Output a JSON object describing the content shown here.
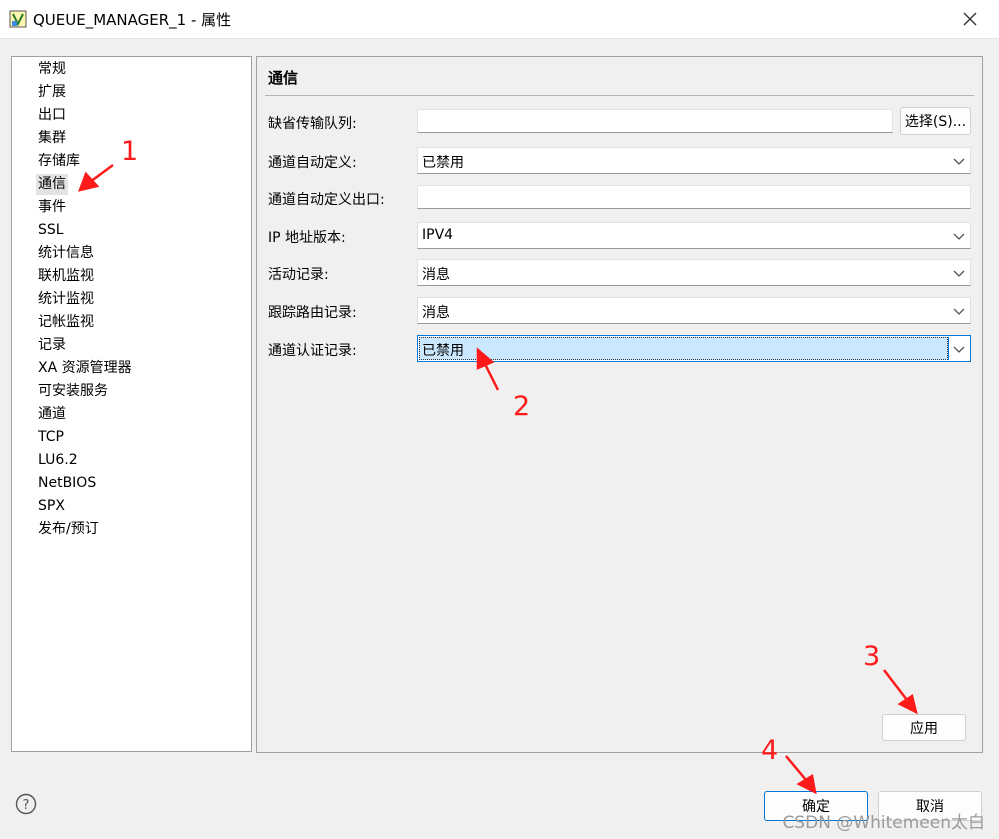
{
  "window": {
    "title": "QUEUE_MANAGER_1 - 属性"
  },
  "tree": {
    "items": [
      {
        "label": "常规"
      },
      {
        "label": "扩展"
      },
      {
        "label": "出口"
      },
      {
        "label": "集群"
      },
      {
        "label": "存储库"
      },
      {
        "label": "通信",
        "selected": true
      },
      {
        "label": "事件"
      },
      {
        "label": "SSL"
      },
      {
        "label": "统计信息"
      },
      {
        "label": "联机监视"
      },
      {
        "label": "统计监视"
      },
      {
        "label": "记帐监视"
      },
      {
        "label": "记录"
      },
      {
        "label": "XA 资源管理器"
      },
      {
        "label": "可安装服务"
      },
      {
        "label": "通道"
      },
      {
        "label": "TCP"
      },
      {
        "label": "LU6.2"
      },
      {
        "label": "NetBIOS"
      },
      {
        "label": "SPX"
      },
      {
        "label": "发布/预订"
      }
    ]
  },
  "panel": {
    "title": "通信",
    "fields": {
      "default_xmit_queue": {
        "label": "缺省传输队列:",
        "value": "",
        "select_label": "选择(S)..."
      },
      "chad": {
        "label": "通道自动定义:",
        "value": "已禁用"
      },
      "chad_exit": {
        "label": "通道自动定义出口:",
        "value": ""
      },
      "ip_version": {
        "label": "IP 地址版本:",
        "value": "IPV4"
      },
      "activity_recording": {
        "label": "活动记录:",
        "value": "消息"
      },
      "trace_route_recording": {
        "label": "跟踪路由记录:",
        "value": "消息"
      },
      "channel_auth_recording": {
        "label": "通道认证记录:",
        "value": "已禁用"
      }
    },
    "apply_label": "应用"
  },
  "footer": {
    "ok_label": "确定",
    "cancel_label": "取消"
  },
  "annotations": [
    "1",
    "2",
    "3",
    "4"
  ],
  "watermark": "CSDN @Whitemeen太白",
  "colors": {
    "accent": "#0078d7",
    "annotation": "#ff1a1a"
  }
}
